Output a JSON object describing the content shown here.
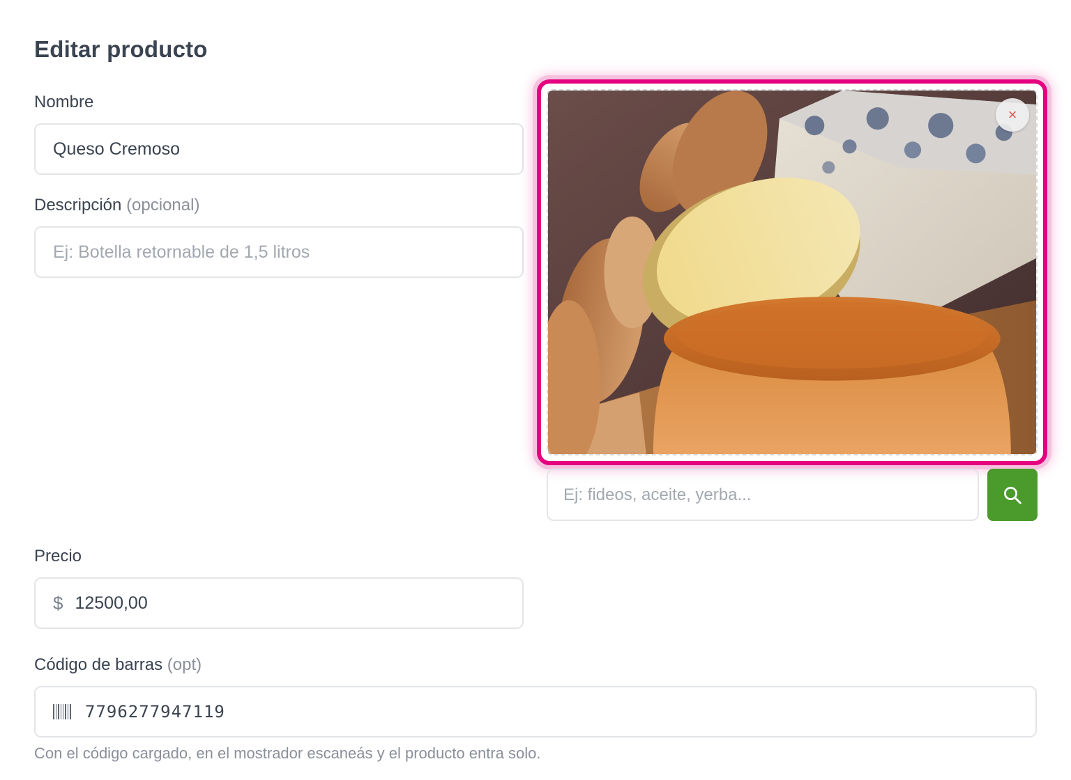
{
  "dialog": {
    "title": "Editar producto"
  },
  "name": {
    "label": "Nombre",
    "value": "Queso Cremoso"
  },
  "description": {
    "label": "Descripción",
    "optional": "(opcional)",
    "placeholder": "Ej: Botella retornable de 1,5 litros"
  },
  "image": {
    "alt_icon": "close-icon",
    "close_glyph": "×"
  },
  "image_search": {
    "placeholder": "Ej: fideos, aceite, yerba...",
    "button_icon": "search-icon"
  },
  "price": {
    "label": "Precio",
    "currency": "$",
    "value": "12500,00"
  },
  "barcode": {
    "label": "Código de barras",
    "optional": "(opt)",
    "value": "7796277947119",
    "icon": "barcode-icon",
    "hint": "Con el código cargado, en el mostrador escaneás y el producto entra solo."
  },
  "colors": {
    "accent": "#e4007e",
    "search_button": "#4a9a2c",
    "text": "#3a4350",
    "muted": "#8a8f99"
  }
}
